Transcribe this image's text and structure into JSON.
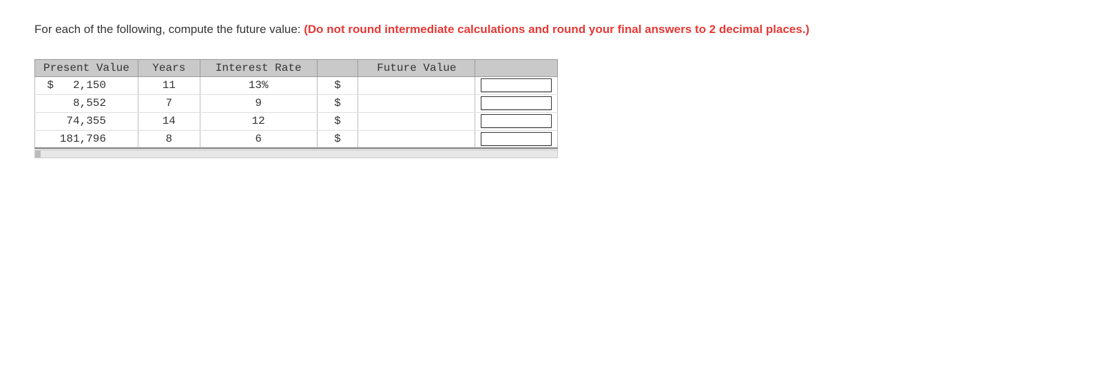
{
  "instructions": {
    "prefix": "For each of the following, compute the future value: ",
    "highlight": "(Do not round intermediate calculations and round your final answers to 2 decimal places.)"
  },
  "headers": {
    "present_value": "Present Value",
    "years": "Years",
    "interest_rate": "Interest Rate",
    "future_value": "Future Value"
  },
  "rows": [
    {
      "pv_symbol": "$",
      "pv": "2,150",
      "years": "11",
      "rate": "13%",
      "fv_symbol": "$",
      "fv": ""
    },
    {
      "pv_symbol": "",
      "pv": "8,552",
      "years": "7",
      "rate": "9",
      "fv_symbol": "$",
      "fv": ""
    },
    {
      "pv_symbol": "",
      "pv": "74,355",
      "years": "14",
      "rate": "12",
      "fv_symbol": "$",
      "fv": ""
    },
    {
      "pv_symbol": "",
      "pv": "181,796",
      "years": "8",
      "rate": "6",
      "fv_symbol": "$",
      "fv": ""
    }
  ],
  "chart_data": {
    "type": "table",
    "columns": [
      "Present Value",
      "Years",
      "Interest Rate",
      "Future Value"
    ],
    "rows": [
      [
        "$ 2,150",
        "11",
        "13%",
        ""
      ],
      [
        "8,552",
        "7",
        "9",
        ""
      ],
      [
        "74,355",
        "14",
        "12",
        ""
      ],
      [
        "181,796",
        "8",
        "6",
        ""
      ]
    ]
  }
}
